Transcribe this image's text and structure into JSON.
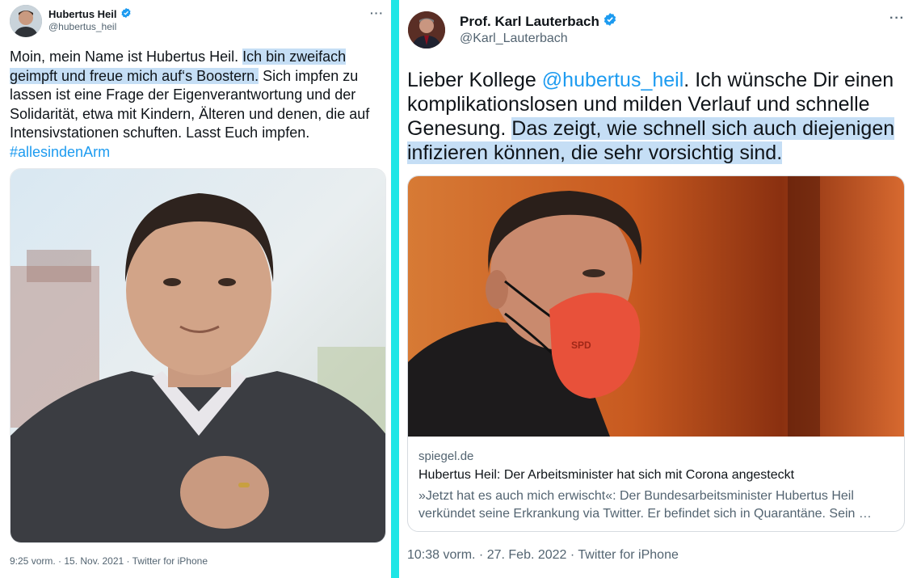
{
  "colors": {
    "divider": "#1ee6e6",
    "highlight": "#c5def5",
    "link": "#1d9bf0",
    "verified": "#1d9bf0"
  },
  "left_tweet": {
    "author_name": "Hubertus Heil",
    "author_handle": "@hubertus_heil",
    "more_label": "···",
    "text_plain_1": "Moin, mein Name ist Hubertus Heil. ",
    "text_highlight": "Ich bin zweifach geimpft und freue mich auf‘s Boostern.",
    "text_plain_2": " Sich impfen zu lassen ist eine Frage der Eigenverantwortung und der Solidarität, etwa mit Kindern, Älteren  und denen, die auf Intensivstationen schuften. Lasst Euch impfen.",
    "hashtag": "#allesindenArm",
    "timestamp": "9:25 vorm. · 15. Nov. 2021 · Twitter for iPhone"
  },
  "right_tweet": {
    "author_name": "Prof. Karl Lauterbach",
    "author_handle": "@Karl_Lauterbach",
    "more_label": "···",
    "text_plain_1": "Lieber Kollege ",
    "mention": "@hubertus_heil",
    "text_plain_2": ". Ich wünsche Dir einen komplikationslosen und milden Verlauf und schnelle Genesung. ",
    "text_highlight": "Das zeigt, wie schnell sich auch diejenigen infizieren können, die sehr vorsichtig sind.",
    "card": {
      "domain": "spiegel.de",
      "title": "Hubertus Heil: Der Arbeitsminister hat sich mit Corona angesteckt",
      "description": "»Jetzt hat es auch mich erwischt«: Der Bundesarbeitsminister Hubertus Heil verkündet seine Erkrankung via Twitter. Er befindet sich in Quarantäne. Sein …"
    },
    "mask_label": "SPD",
    "timestamp": "10:38 vorm. · 27. Feb. 2022 · Twitter for iPhone"
  }
}
